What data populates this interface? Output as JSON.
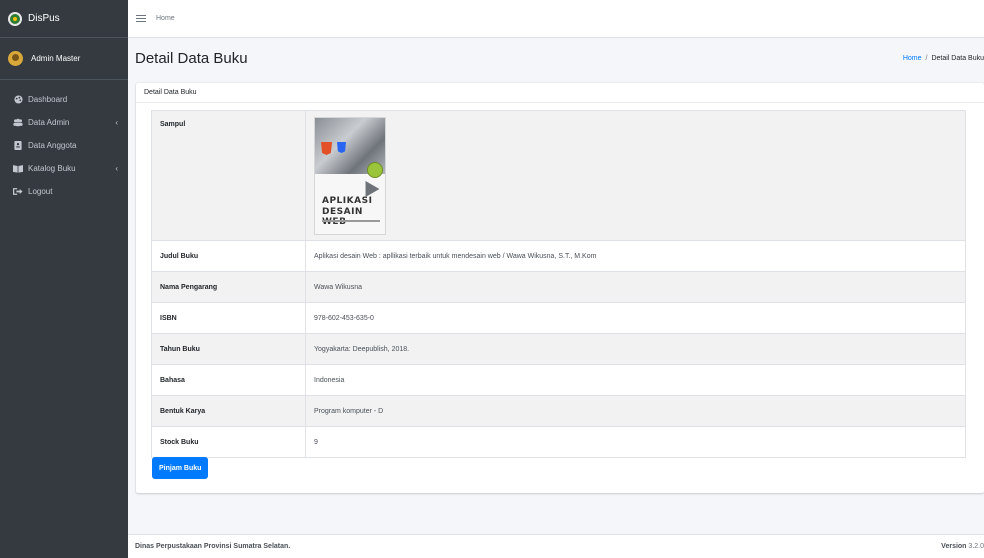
{
  "brand": {
    "name": "DisPus"
  },
  "user": {
    "name": "Admin Master"
  },
  "sidebar": {
    "items": [
      {
        "label": "Dashboard",
        "icon": "palette-icon",
        "has_caret": false
      },
      {
        "label": "Data Admin",
        "icon": "users-icon",
        "has_caret": true
      },
      {
        "label": "Data Anggota",
        "icon": "id-card-icon",
        "has_caret": false
      },
      {
        "label": "Katalog Buku",
        "icon": "book-icon",
        "has_caret": true
      },
      {
        "label": "Logout",
        "icon": "sign-out-icon",
        "has_caret": false
      }
    ]
  },
  "topbar": {
    "home_label": "Home"
  },
  "header": {
    "title": "Detail Data Buku",
    "breadcrumb": {
      "home": "Home",
      "separator": "/",
      "active": "Detail Data Buku"
    }
  },
  "card": {
    "title": "Detail Data Buku",
    "rows": [
      {
        "label": "Sampul",
        "value": ""
      },
      {
        "label": "Judul Buku",
        "value": "Aplikasi desain Web : apllikasi terbaik untuk mendesain web / Wawa Wikusna, S.T., M.Kom"
      },
      {
        "label": "Nama Pengarang",
        "value": "Wawa Wikusna"
      },
      {
        "label": "ISBN",
        "value": "978-602-453-635-0"
      },
      {
        "label": "Tahun Buku",
        "value": "Yogyakarta: Deepublish, 2018."
      },
      {
        "label": "Bahasa",
        "value": "Indonesia"
      },
      {
        "label": "Bentuk Karya",
        "value": "Program komputer - D"
      },
      {
        "label": "Stock Buku",
        "value": "9"
      }
    ],
    "cover": {
      "title_line1": "APLIKASI",
      "title_line2": "DESAIN WEB"
    },
    "button_label": "Pinjam Buku"
  },
  "footer": {
    "left": "Dinas Perpustakaan Provinsi Sumatra Selatan.",
    "version_label": "Version",
    "version_number": "3.2.0"
  },
  "colors": {
    "sidebar_bg": "#343a40",
    "primary": "#007bff",
    "content_bg": "#f4f6f9"
  }
}
